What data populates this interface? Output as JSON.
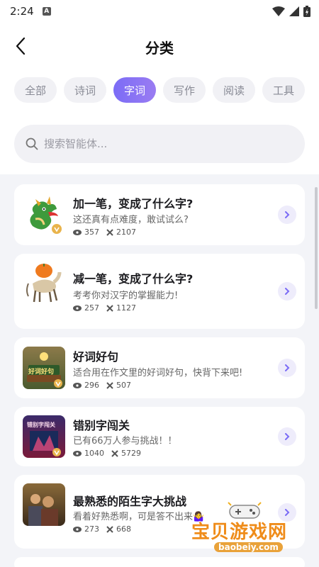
{
  "status": {
    "time": "2:24",
    "notification_letter": "A"
  },
  "header": {
    "title": "分类",
    "back_icon": "chevron-left-icon"
  },
  "tabs": [
    {
      "label": "全部",
      "active": false
    },
    {
      "label": "诗词",
      "active": false
    },
    {
      "label": "字词",
      "active": true
    },
    {
      "label": "写作",
      "active": false
    },
    {
      "label": "阅读",
      "active": false
    },
    {
      "label": "工具",
      "active": false
    }
  ],
  "search": {
    "placeholder": "搜索智能体..."
  },
  "accent": "#8472f5",
  "items": [
    {
      "title": "加一笔，变成了什么字?",
      "desc": "这还真有点难度，敢试试么?",
      "views": "357",
      "uses": "2107",
      "thumb": "dragon-illustration"
    },
    {
      "title": "减一笔，变成了什么字?",
      "desc": "考考你对汉字的掌握能力!",
      "views": "257",
      "uses": "1127",
      "thumb": "pumpkin-horse-illustration"
    },
    {
      "title": "好词好句",
      "desc": "适合用在作文里的好词好句，快背下来吧!",
      "views": "296",
      "uses": "507",
      "thumb": "book-illustration",
      "thumb_text": "好词好句"
    },
    {
      "title": "错别字闯关",
      "desc": "已有66万人参与挑战！！",
      "views": "1040",
      "uses": "5729",
      "thumb": "game-poster-illustration",
      "thumb_text": "错别字闯关"
    },
    {
      "title": "最熟悉的陌生字大挑战",
      "desc": "看着好熟悉啊，可是答不出来🤷‍♀️",
      "views": "273",
      "uses": "668",
      "thumb": "crowd-photo"
    }
  ],
  "watermark": {
    "text": "宝贝游戏网",
    "url": "baobeiy.com"
  }
}
